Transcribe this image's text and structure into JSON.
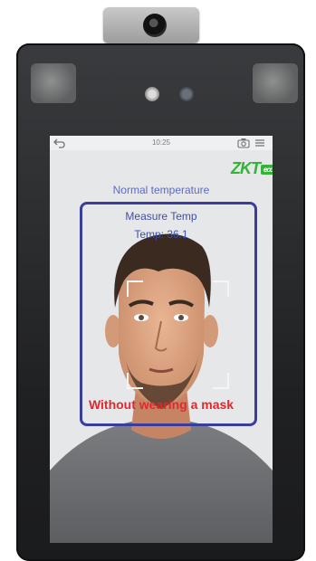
{
  "status_bar": {
    "time": "10:25",
    "back_icon": "back-arrow-icon",
    "camera_icon": "camera-icon",
    "menu_icon": "menu-icon"
  },
  "brand": {
    "logo_text": "ZKT",
    "logo_suffix": "eco",
    "color": "#34b23a"
  },
  "overlay": {
    "status": "Normal temperature",
    "measure_label": "Measure Temp",
    "temperature": "Temp: 36.1",
    "mask_warning": "Without wearing a mask"
  },
  "colors": {
    "frame": "#3b3d9c",
    "status_text": "#5b6bc7",
    "warning": "#e3272d"
  }
}
